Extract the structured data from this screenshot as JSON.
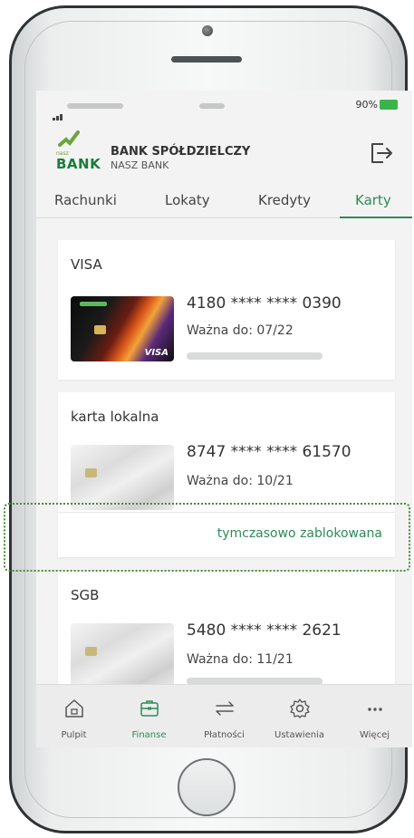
{
  "bank": {
    "logo_small": "nasz",
    "logo_text": "BANK",
    "name": "BANK SPÓŁDZIELCZY",
    "subtitle": "NASZ BANK"
  },
  "status": {
    "battery": "90%"
  },
  "tabs": [
    {
      "label": "Rachunki",
      "active": false
    },
    {
      "label": "Lokaty",
      "active": false
    },
    {
      "label": "Kredyty",
      "active": false
    },
    {
      "label": "Karty",
      "active": true
    }
  ],
  "cards": [
    {
      "title": "VISA",
      "number": "4180 **** **** 0390",
      "valid": "Ważna do: 07/22",
      "brand_mark": "VISA"
    },
    {
      "title": "karta lokalna",
      "number": "8747 **** **** 61570",
      "valid": "Ważna do: 10/21",
      "status": "tymczasowo zablokowana"
    },
    {
      "title": "SGB",
      "number": "5480 **** **** 2621",
      "valid": "Ważna do: 11/21"
    }
  ],
  "nav": [
    {
      "label": "Pulpit",
      "icon": "home-icon"
    },
    {
      "label": "Finanse",
      "icon": "wallet-icon",
      "active": true
    },
    {
      "label": "Płatności",
      "icon": "transfer-arrows-icon"
    },
    {
      "label": "Ustawienia",
      "icon": "gear-icon"
    },
    {
      "label": "Więcej",
      "icon": "more-dots-icon"
    }
  ],
  "colors": {
    "accent": "#2e8b57",
    "logo_green": "#6aa43c",
    "battery": "#3ab54a",
    "highlight_border": "#4a8a35"
  }
}
